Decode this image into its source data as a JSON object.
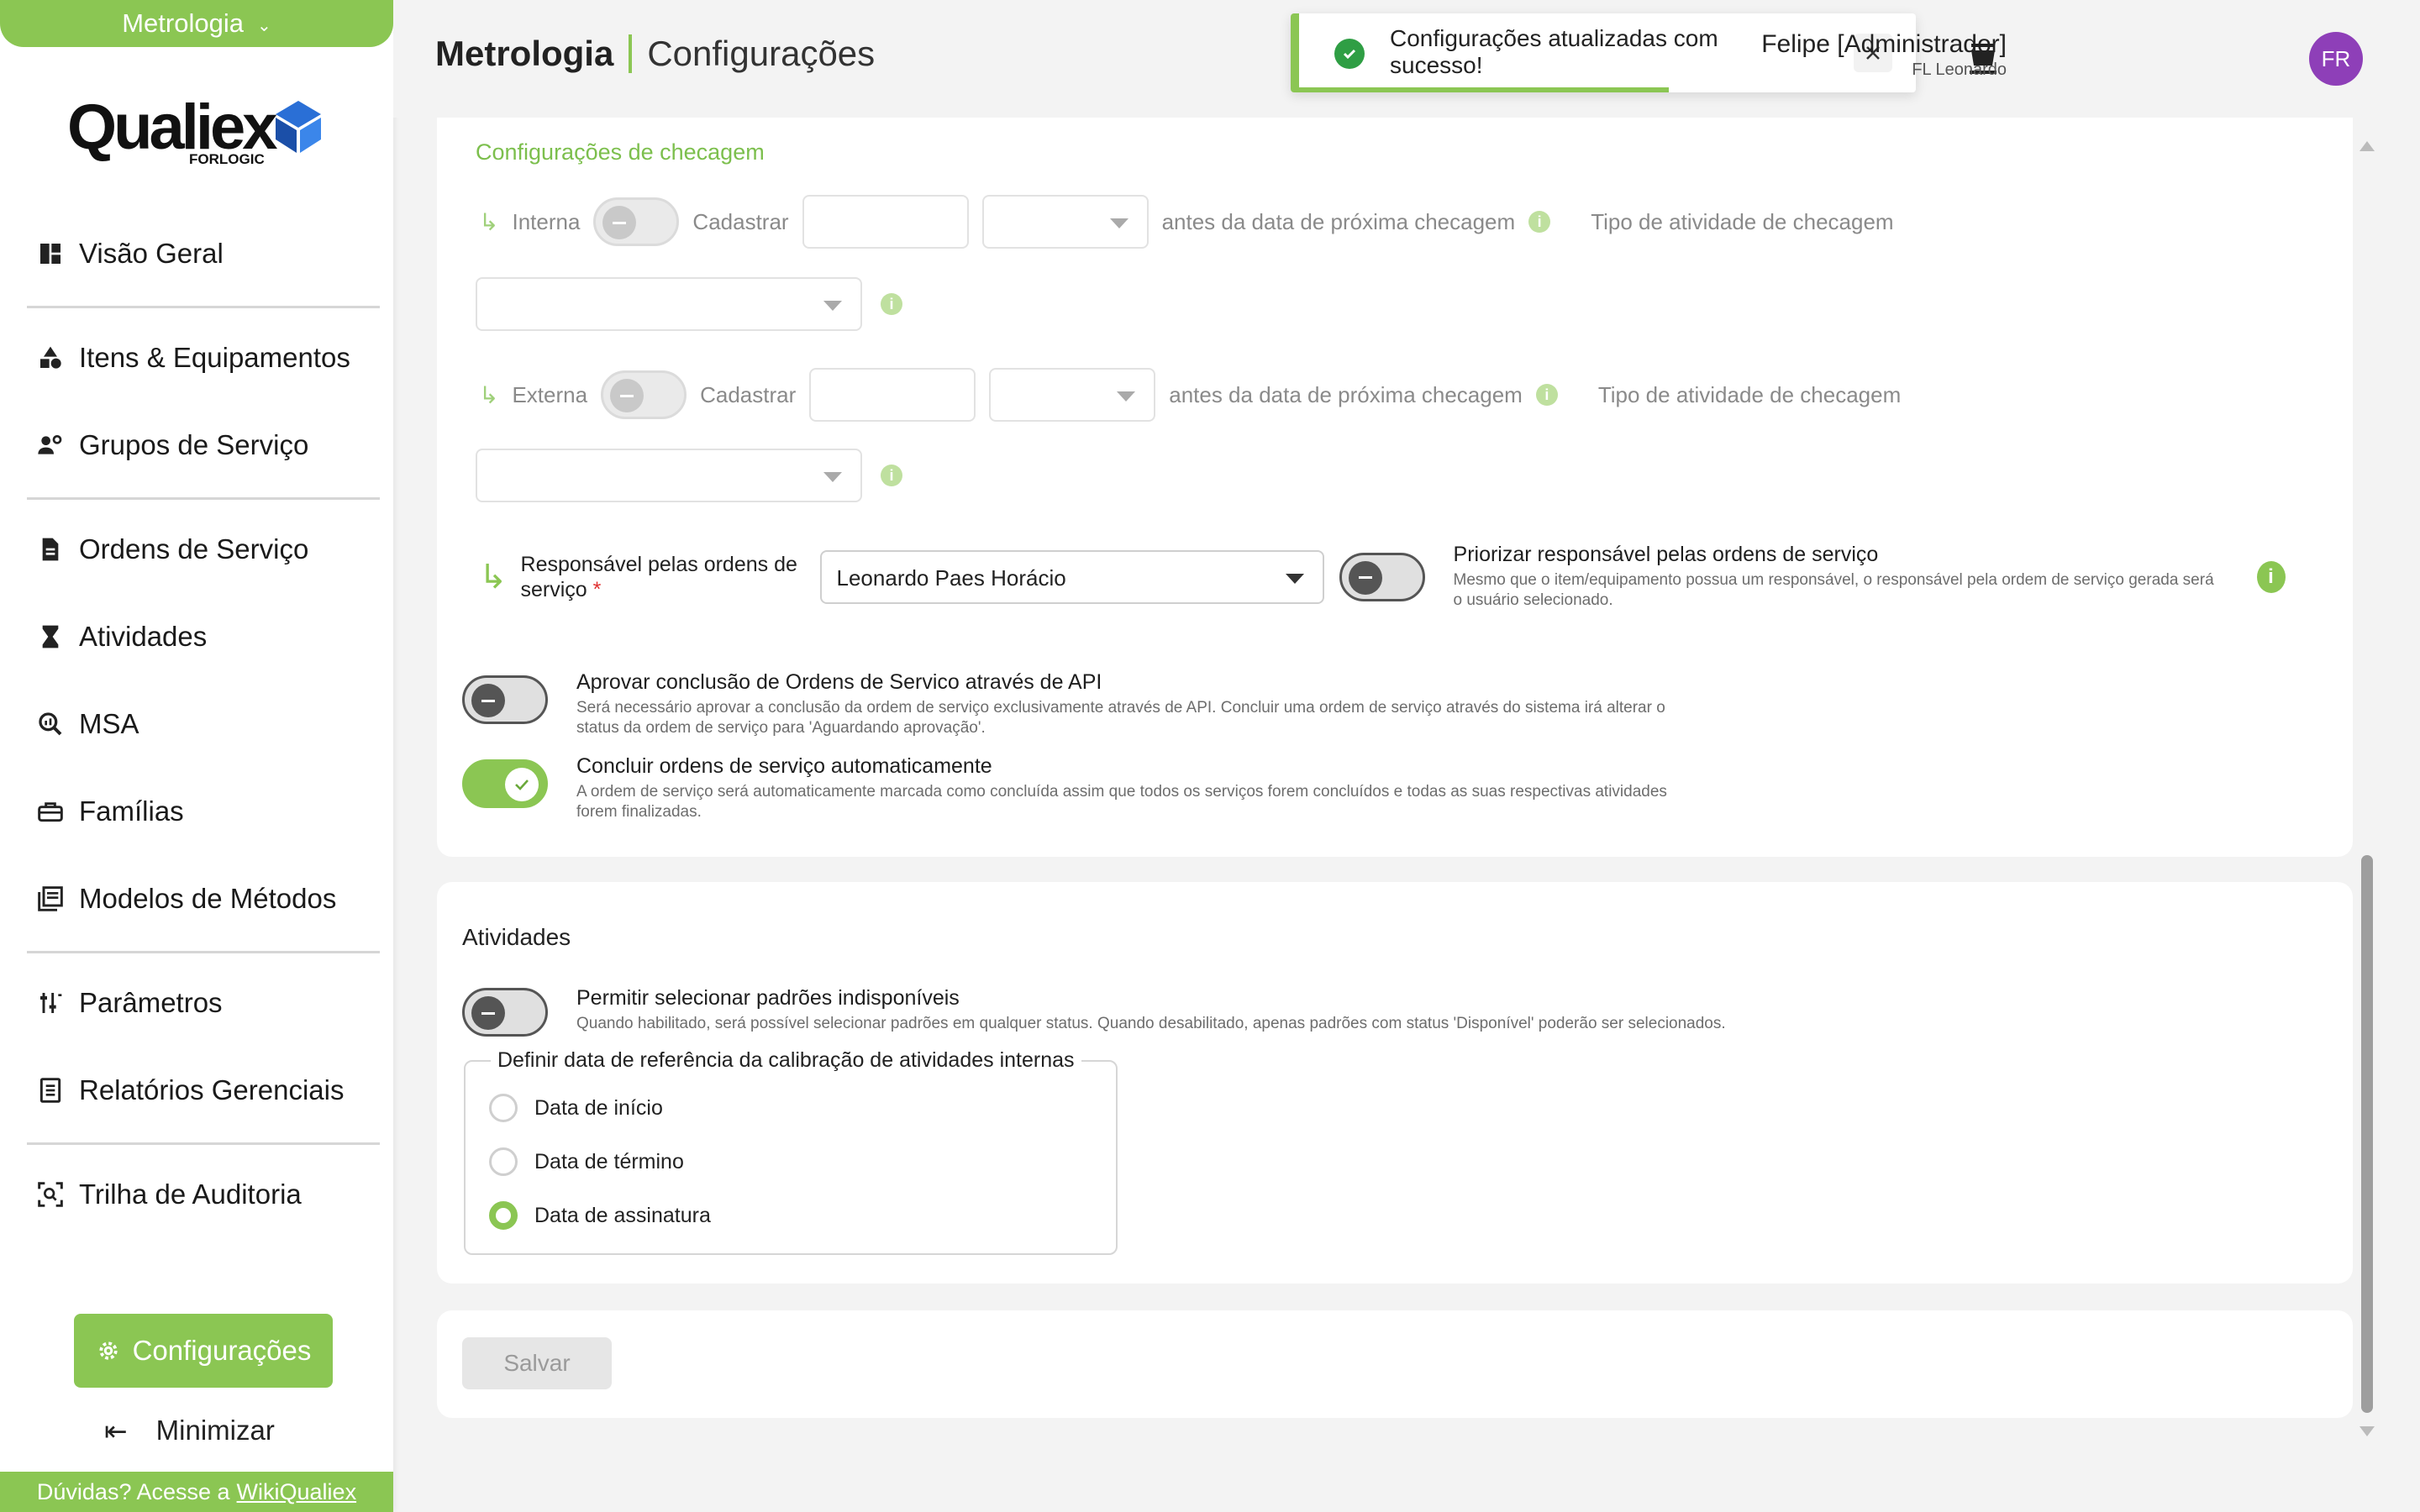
{
  "sidebar": {
    "module": "Metrologia",
    "logo": {
      "name": "Qualiex",
      "sub": "FORLOGIC"
    },
    "items": [
      {
        "label": "Visão Geral",
        "icon": "dashboard-icon"
      },
      {
        "label": "Itens & Equipamentos",
        "icon": "shapes-icon"
      },
      {
        "label": "Grupos de Serviço",
        "icon": "users-gear-icon"
      },
      {
        "label": "Ordens de Serviço",
        "icon": "document-icon"
      },
      {
        "label": "Atividades",
        "icon": "hourglass-icon"
      },
      {
        "label": "MSA",
        "icon": "magnify-chart-icon"
      },
      {
        "label": "Famílias",
        "icon": "toolbox-icon"
      },
      {
        "label": "Modelos de Métodos",
        "icon": "book-icon"
      },
      {
        "label": "Parâmetros",
        "icon": "sliders-icon"
      },
      {
        "label": "Relatórios Gerenciais",
        "icon": "report-icon"
      },
      {
        "label": "Trilha de Auditoria",
        "icon": "audit-scan-icon"
      }
    ],
    "config_label": "Configurações",
    "minimize_label": "Minimizar",
    "help": {
      "text": "Dúvidas? Acesse a",
      "link": "WikiQualiex"
    }
  },
  "header": {
    "module": "Metrologia",
    "page": "Configurações",
    "toast": {
      "message": "Configurações atualizadas com sucesso!",
      "progress": 0.6
    },
    "user": {
      "name": "Felipe [Administrador]",
      "org": "FL Leonardo",
      "initials": "FR"
    }
  },
  "checagem": {
    "title": "Configurações de checagem",
    "interna": {
      "label": "Interna",
      "cadastrar": "Cadastrar",
      "antes": "antes da data de próxima checagem",
      "tipo": "Tipo de atividade de checagem",
      "enabled": false
    },
    "externa": {
      "label": "Externa",
      "cadastrar": "Cadastrar",
      "antes": "antes da data de próxima checagem",
      "tipo": "Tipo de atividade de checagem",
      "enabled": false
    },
    "responsavel": {
      "label": "Responsável pelas ordens de serviço",
      "required_mark": "*",
      "value": "Leonardo Paes Horácio",
      "priorizar_title": "Priorizar responsável pelas ordens de serviço",
      "priorizar_desc": "Mesmo que o item/equipamento possua um responsável, o responsável pela ordem de serviço gerada será o usuário selecionado.",
      "priorizar_enabled": false
    },
    "aprovar": {
      "title": "Aprovar conclusão de Ordens de Servico através de API",
      "desc": "Será necessário aprovar a conclusão da ordem de serviço exclusivamente através de API. Concluir uma ordem de serviço através do sistema irá alterar o status da ordem de serviço para 'Aguardando aprovação'.",
      "enabled": false
    },
    "concluir": {
      "title": "Concluir ordens de serviço automaticamente",
      "desc": "A ordem de serviço será automaticamente marcada como concluída assim que todos os serviços forem concluídos e todas as suas respectivas atividades forem finalizadas.",
      "enabled": true
    }
  },
  "atividades": {
    "title": "Atividades",
    "permitir": {
      "title": "Permitir selecionar padrões indisponíveis",
      "desc": "Quando habilitado, será possível selecionar padrões em qualquer status. Quando desabilitado, apenas padrões com status 'Disponível' poderão ser selecionados.",
      "enabled": false
    },
    "referencia": {
      "legend": "Definir data de referência da calibração de atividades internas",
      "options": [
        "Data de início",
        "Data de término",
        "Data de assinatura"
      ],
      "selected": "Data de assinatura"
    }
  },
  "actions": {
    "save_label": "Salvar"
  },
  "colors": {
    "accent": "#8bc653",
    "avatar": "#8e3fb8",
    "success": "#2f9e44"
  }
}
